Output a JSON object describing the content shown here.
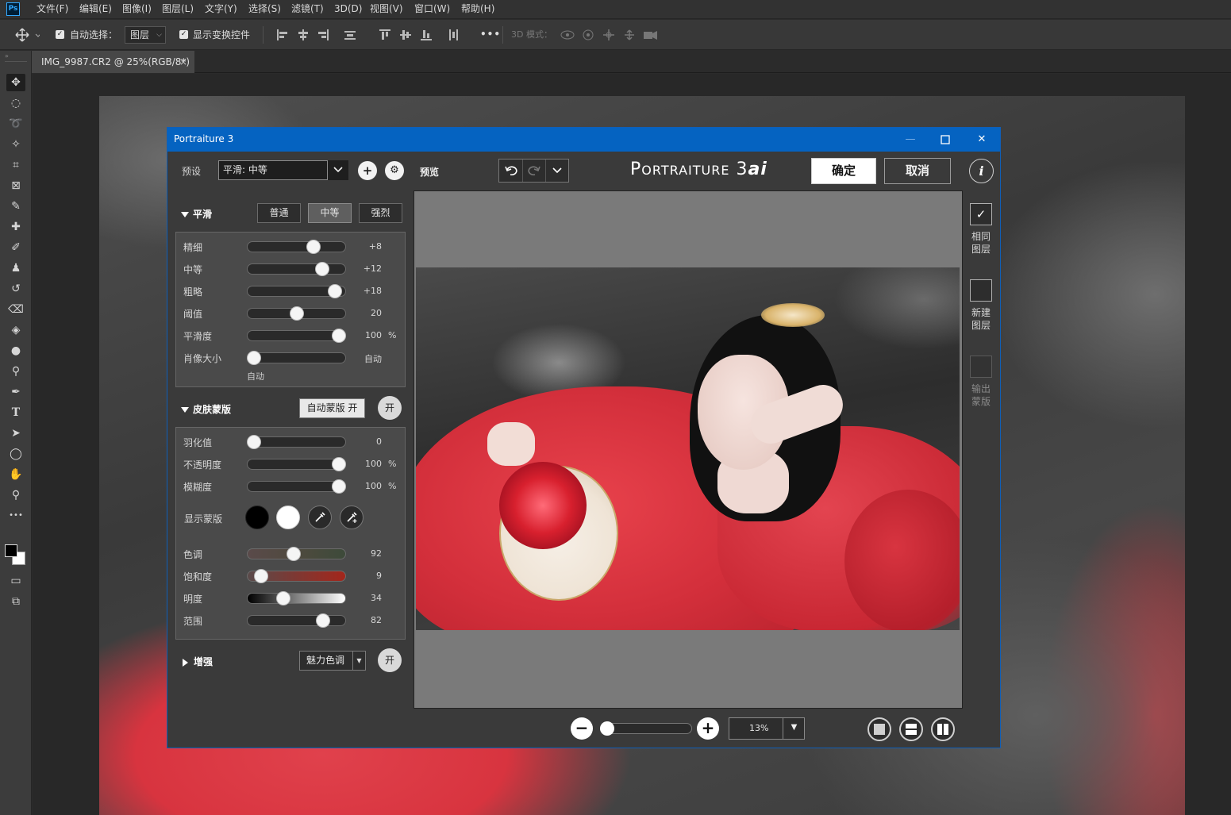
{
  "app": {
    "logo": "Ps",
    "menu": [
      "文件(F)",
      "编辑(E)",
      "图像(I)",
      "图层(L)",
      "文字(Y)",
      "选择(S)",
      "滤镜(T)",
      "3D(D)",
      "视图(V)",
      "窗口(W)",
      "帮助(H)"
    ]
  },
  "options": {
    "auto_select_label": "自动选择：",
    "auto_select_target": "图层",
    "show_transform_label": "显示变换控件",
    "more": "•••",
    "mode3d_label": "3D 模式："
  },
  "document": {
    "tab_title": "IMG_9987.CR2 @ 25%(RGB/8*)",
    "close": "×"
  },
  "tools": [
    "move",
    "marquee",
    "lasso",
    "magic-wand",
    "crop",
    "frame",
    "eyedropper",
    "healing",
    "brush",
    "stamp",
    "history-brush",
    "eraser",
    "paint-bucket",
    "blur",
    "dodge",
    "pen",
    "type",
    "path-select",
    "ellipse",
    "hand",
    "zoom",
    "more"
  ],
  "dialog": {
    "title": "Portraiture 3",
    "min": "—",
    "max": "☐",
    "close": "✕",
    "preset_label": "预设",
    "preset_value": "平滑: 中等",
    "smoothing": {
      "title": "平滑",
      "modes": [
        "普通",
        "中等",
        "强烈"
      ],
      "selected_mode": "中等",
      "sliders": [
        {
          "label": "精细",
          "value": "+8",
          "unit": "",
          "pos": 0.68
        },
        {
          "label": "中等",
          "value": "+12",
          "unit": "",
          "pos": 0.77
        },
        {
          "label": "粗略",
          "value": "+18",
          "unit": "",
          "pos": 0.91
        },
        {
          "label": "阈值",
          "value": "20",
          "unit": "",
          "pos": 0.5
        },
        {
          "label": "平滑度",
          "value": "100",
          "unit": "%",
          "pos": 0.95
        },
        {
          "label": "肖像大小",
          "value": "自动",
          "unit": "",
          "pos": 0.05
        }
      ],
      "portrait_size_note": "自动"
    },
    "skin_mask": {
      "title": "皮肤蒙版",
      "auto_mask_button": "自动蒙版 开",
      "on_label": "开",
      "sliders": [
        {
          "label": "羽化值",
          "value": "0",
          "unit": "",
          "pos": 0.05
        },
        {
          "label": "不透明度",
          "value": "100",
          "unit": "%",
          "pos": 0.95
        },
        {
          "label": "模糊度",
          "value": "100",
          "unit": "%",
          "pos": 0.95
        }
      ],
      "show_mask_label": "显示蒙版",
      "color_sliders": [
        {
          "label": "色调",
          "value": "92",
          "pos": 0.47,
          "track": "linear-gradient(90deg,#5a4a4a,#4f4a3e,#3d4a3a)"
        },
        {
          "label": "饱和度",
          "value": "9",
          "pos": 0.13,
          "track": "linear-gradient(90deg,#5a4a4a,#a3261b)"
        },
        {
          "label": "明度",
          "value": "34",
          "pos": 0.36,
          "track": "linear-gradient(90deg,#000000,#ffffff)"
        },
        {
          "label": "范围",
          "value": "82",
          "pos": 0.78,
          "track": "linear-gradient(90deg,#2a2a2a,#2a2a2a)"
        }
      ]
    },
    "enhance": {
      "title": "增强",
      "dropdown": "魅力色调",
      "on_label": "开"
    },
    "preview_label": "预览",
    "logo_main": "P",
    "logo_rest": "ORTRAITURE",
    "logo_ver": "3",
    "logo_ai": "ai",
    "ok": "确定",
    "cancel": "取消",
    "info": "i",
    "zoom_value": "13%",
    "output_options": [
      {
        "label_1": "相同",
        "label_2": "图层",
        "checked": true
      },
      {
        "label_1": "新建",
        "label_2": "图层",
        "checked": false
      },
      {
        "label_1": "输出",
        "label_2": "蒙版",
        "checked": false
      }
    ]
  }
}
